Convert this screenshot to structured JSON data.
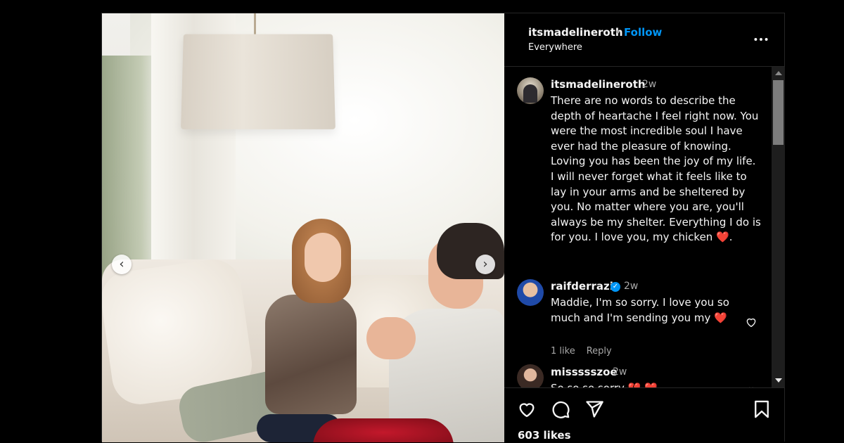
{
  "post": {
    "username": "itsmadelineroth",
    "separator": "•",
    "follow_label": "Follow",
    "location": "Everywhere",
    "more_icon": "more-horizontal-icon"
  },
  "caption": {
    "username": "itsmadelineroth",
    "time": "2w",
    "text_before_heart": "There are no words to describe the depth of heartache I feel right now. You were the most incredible soul I have ever had the pleasure of knowing. Loving you has been the joy of my life. I will never forget what it feels like to lay in your arms and be sheltered by you. No matter where you are, you'll always be my shelter. Everything I do is for you. I love you, my chicken ",
    "heart": "❤️",
    "text_after_heart": "."
  },
  "comments": [
    {
      "username": "raifderrazi",
      "verified_mark": "✓",
      "time": "2w",
      "text": "Maddie, I'm so sorry. I love you so much and I'm sending you my ",
      "heart": "❤️",
      "likes": "1 like",
      "reply_label": "Reply"
    },
    {
      "username": "missssszoe",
      "time": "2w",
      "text": "So so so sorry",
      "hearts": "💔 ❤️"
    }
  ],
  "actions": {
    "like_icon": "heart-icon",
    "comment_icon": "comment-icon",
    "share_icon": "send-icon",
    "save_icon": "bookmark-icon",
    "likes_count": "603 likes"
  },
  "carousel": {
    "prev_glyph": "‹",
    "next_glyph": "›"
  },
  "colors": {
    "background": "#000000",
    "follow": "#0095f6",
    "secondary_text": "#a8a8a8",
    "heart": "#e0245e"
  }
}
